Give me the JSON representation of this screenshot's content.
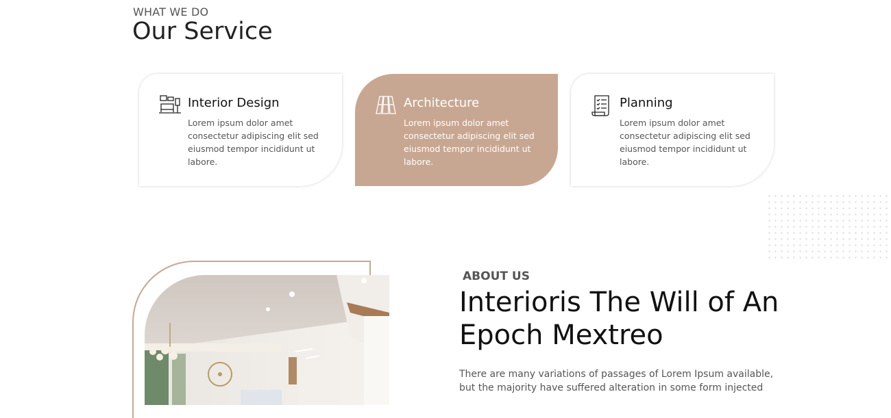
{
  "services": {
    "eyebrow": "WHAT WE DO",
    "title": "Our Service",
    "cards": [
      {
        "title": "Interior Design",
        "icon": "interior-design-icon",
        "lines": [
          "Lorem ipsum dolor amet",
          "consectetur adipiscing elit sed",
          "eiusmod tempor incididunt ut",
          "labore."
        ]
      },
      {
        "title": "Architecture",
        "icon": "architecture-icon",
        "lines": [
          "Lorem ipsum dolor amet",
          "consectetur adipiscing elit sed",
          "eiusmod tempor incididunt ut",
          "labore."
        ]
      },
      {
        "title": "Planning",
        "icon": "planning-icon",
        "lines": [
          "Lorem ipsum dolor amet",
          "consectetur adipiscing elit sed",
          "eiusmod tempor incididunt ut",
          "labore."
        ]
      }
    ]
  },
  "about": {
    "eyebrow": "ABOUT US",
    "title_line1": "Interioris The Will of An",
    "title_line2": "Epoch Mextreo",
    "text_line1": "There are many variations of passages of Lorem Ipsum available,",
    "text_line2": "but the majority have suffered alteration in some form injected"
  },
  "colors": {
    "accent": "#c8a792",
    "text_dark": "#222222",
    "text_body": "#555555"
  }
}
